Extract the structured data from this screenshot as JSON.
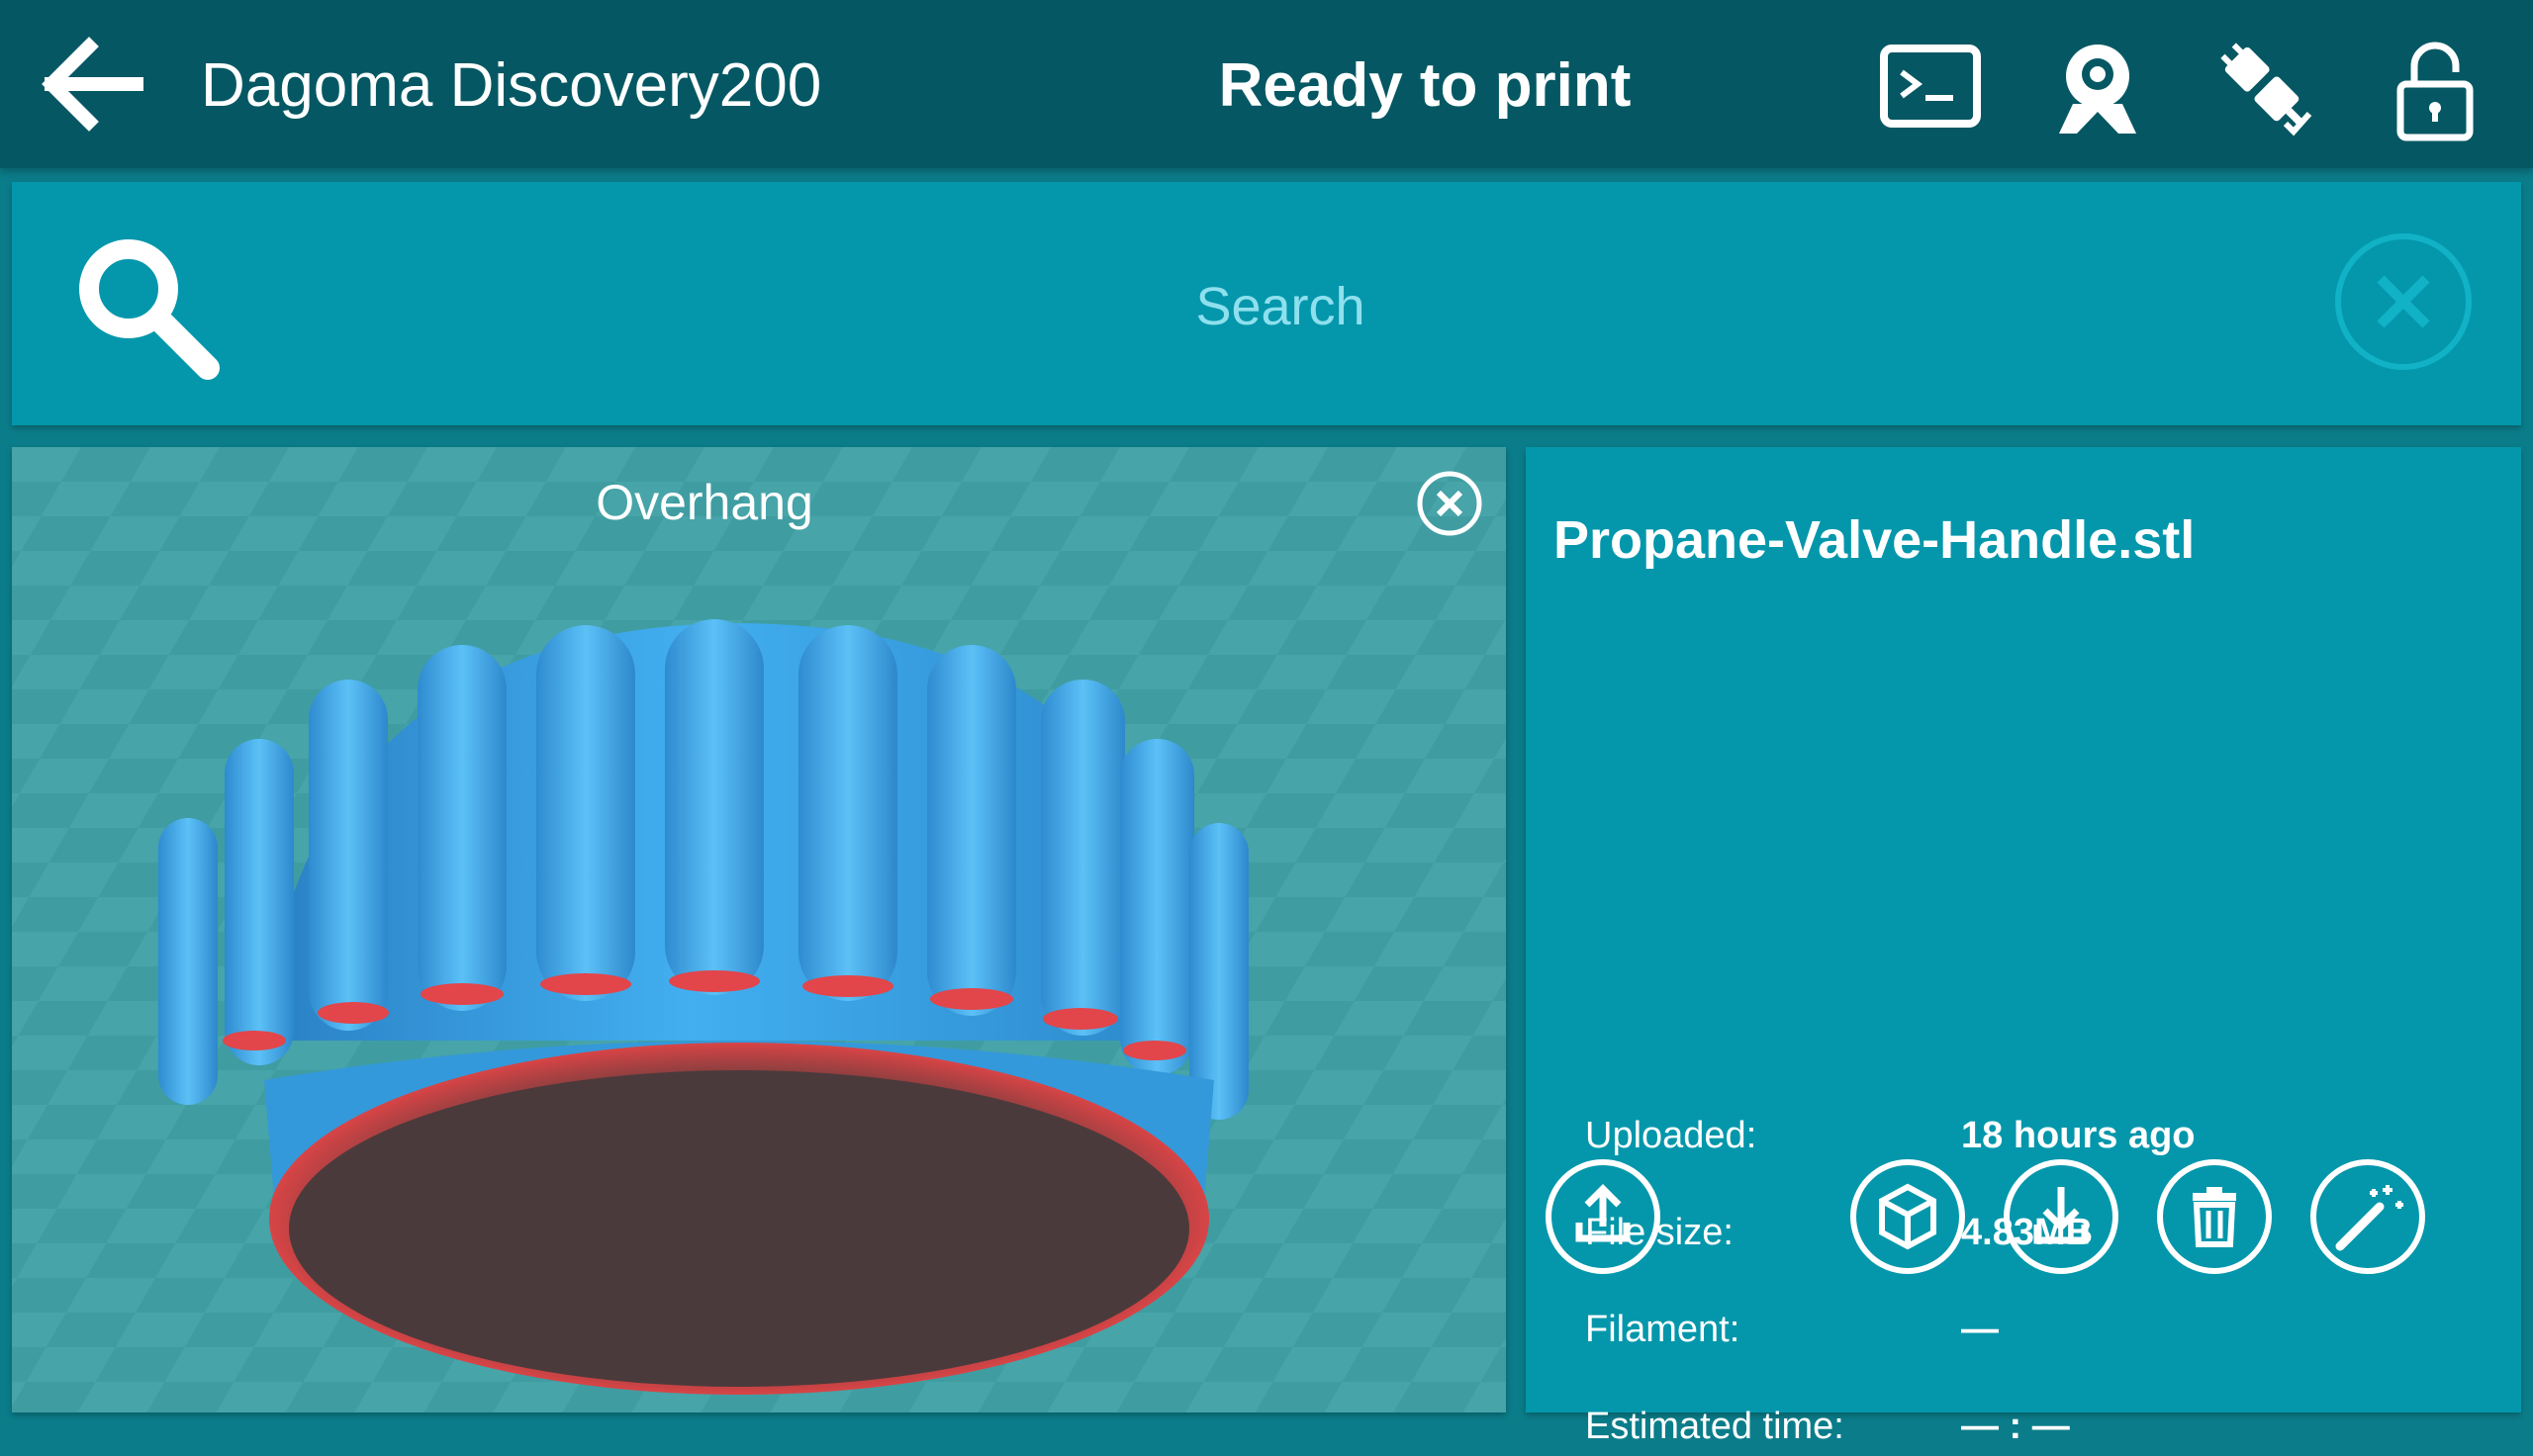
{
  "header": {
    "printer_name": "Dagoma Discovery200",
    "status": "Ready to print"
  },
  "search": {
    "placeholder": "Search"
  },
  "viewer": {
    "title": "Overhang"
  },
  "file": {
    "name": "Propane-Valve-Handle.stl",
    "details": [
      {
        "label": "Uploaded:",
        "value": "18 hours ago"
      },
      {
        "label": "File size:",
        "value": "4.83MB"
      },
      {
        "label": "Filament:",
        "value": "—"
      },
      {
        "label": "Estimated time:",
        "value": "— : —"
      }
    ]
  },
  "colors": {
    "header_bg": "#055863",
    "panel_bg": "#0497ab",
    "body_bg": "#0b7d8a",
    "model_blue": "#3aa6e6",
    "overhang_red": "#e2454a"
  },
  "icons": {
    "back": "arrow-left-icon",
    "terminal": "terminal-icon",
    "webcam": "webcam-icon",
    "connection": "plug-icon",
    "lock": "lock-icon",
    "search": "search-icon",
    "clear": "close-icon",
    "upload": "upload-icon",
    "view_3d": "cube-icon",
    "download": "download-icon",
    "delete": "trash-icon",
    "slice": "magic-wand-icon"
  }
}
